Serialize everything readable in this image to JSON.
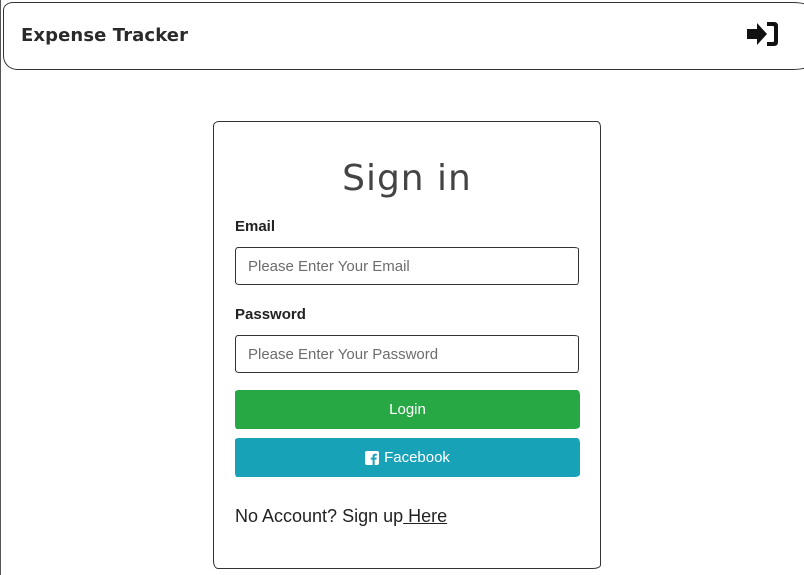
{
  "navbar": {
    "brand": "Expense Tracker",
    "login_icon": "sign-in-icon"
  },
  "signin_form": {
    "title": "Sign in",
    "email": {
      "label": "Email",
      "placeholder": "Please Enter Your Email",
      "value": ""
    },
    "password": {
      "label": "Password",
      "placeholder": "Please Enter Your Password",
      "value": ""
    },
    "login_button": "Login",
    "facebook_button": {
      "label": "Facebook",
      "icon": "facebook-icon"
    },
    "signup_prompt": "No Account? Sign up",
    "signup_link": " Here"
  },
  "colors": {
    "login_button": "#28a745",
    "facebook_button": "#17a2b8",
    "border": "#333333"
  }
}
